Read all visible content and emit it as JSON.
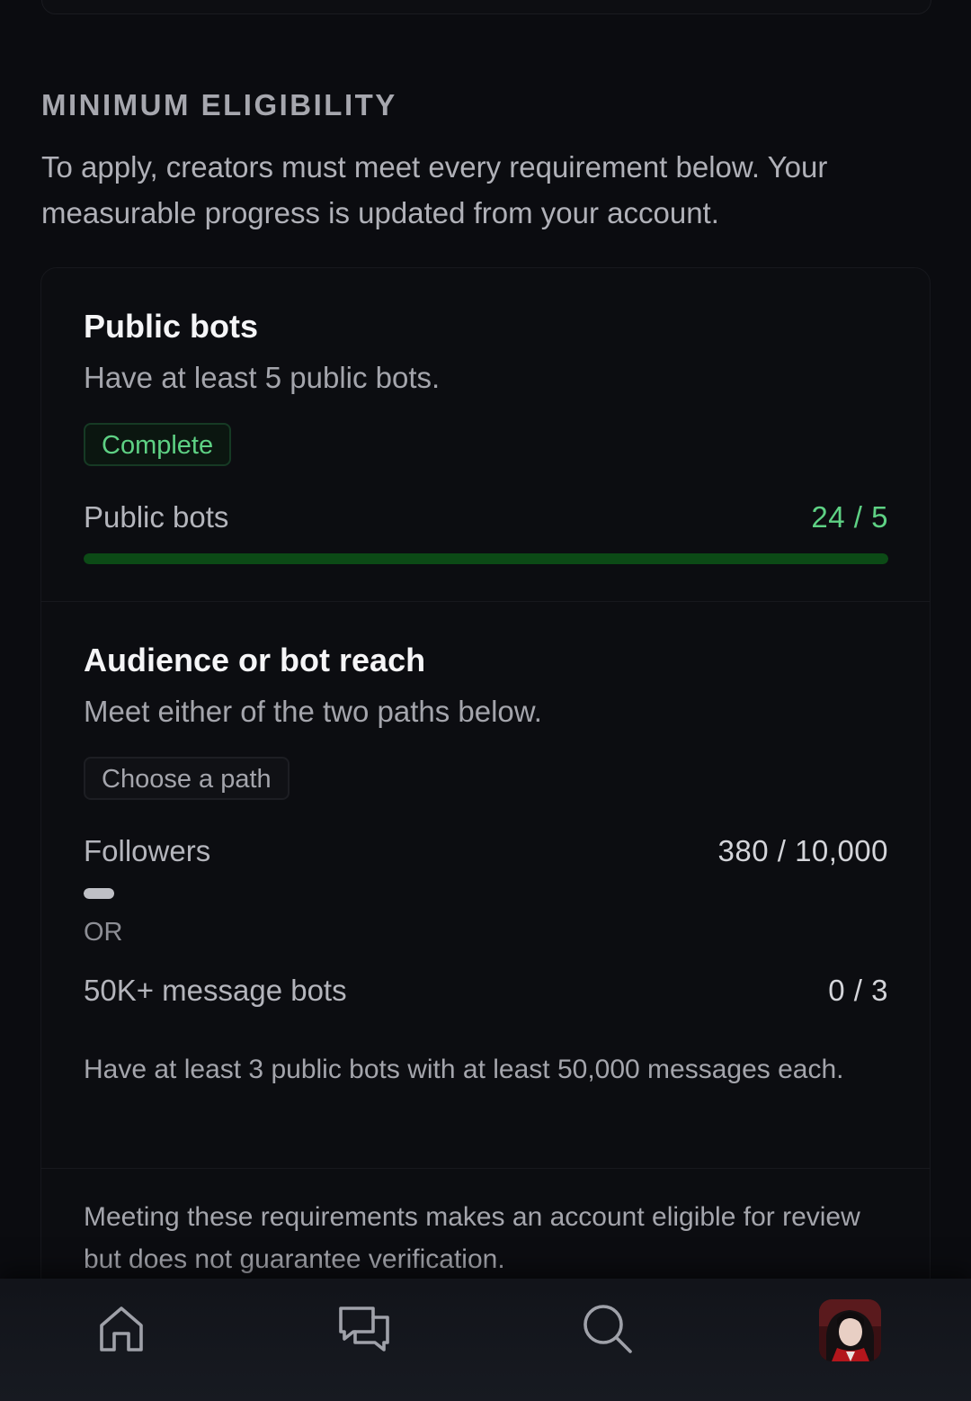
{
  "eligibility": {
    "title": "MINIMUM ELIGIBILITY",
    "description": "To apply, creators must meet every requirement below. Your measurable progress is updated from your account."
  },
  "requirements": [
    {
      "title": "Public bots",
      "description": "Have at least 5 public bots.",
      "status": "Complete",
      "metric": {
        "label": "Public bots",
        "value_text": "24 / 5",
        "current": 24,
        "target": 5,
        "progress": 1.0
      }
    },
    {
      "title": "Audience or bot reach",
      "description": "Meet either of the two paths below.",
      "status": "Choose a path",
      "metric_a": {
        "label": "Followers",
        "value_text": "380 / 10,000",
        "current": 380,
        "target": 10000,
        "progress": 0.038
      },
      "separator": "OR",
      "metric_b": {
        "label": "50K+ message bots",
        "value_text": "0 / 3",
        "current": 0,
        "target": 3
      },
      "helper": "Have at least 3 public bots with at least 50,000 messages each."
    }
  ],
  "disclaimer": "Meeting these requirements makes an account eligible for review but does not guarantee verification.",
  "colors": {
    "complete_green": "#5ed184",
    "progress_green": "#0c4a16",
    "background": "#0b0c10",
    "muted_text": "#a4a5ac"
  },
  "nav": {
    "items": [
      {
        "icon": "home-icon"
      },
      {
        "icon": "chat-icon"
      },
      {
        "icon": "search-icon"
      },
      {
        "icon": "profile-avatar"
      }
    ]
  }
}
